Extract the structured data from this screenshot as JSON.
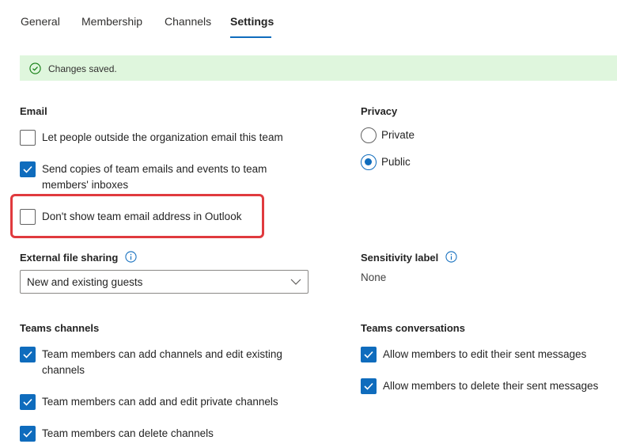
{
  "tabs": {
    "general": "General",
    "membership": "Membership",
    "channels": "Channels",
    "settings": "Settings"
  },
  "banner": {
    "message": "Changes saved."
  },
  "email": {
    "title": "Email",
    "outside_email": {
      "label": "Let people outside the organization email this team",
      "checked": false
    },
    "send_copies": {
      "label_line1": "Send copies of team emails and events to team",
      "label_line2": "members' inboxes",
      "checked": true
    },
    "hide_address": {
      "label": "Don't show team email address in Outlook",
      "checked": false
    }
  },
  "privacy": {
    "title": "Privacy",
    "options": [
      {
        "label": "Private",
        "selected": false
      },
      {
        "label": "Public",
        "selected": true
      }
    ]
  },
  "external_sharing": {
    "title": "External file sharing",
    "selected": "New and existing guests"
  },
  "sensitivity": {
    "title": "Sensitivity label",
    "value": "None"
  },
  "teams_channels": {
    "title": "Teams channels",
    "add_edit": {
      "label_line1": "Team members can add channels and edit existing",
      "label_line2": "channels",
      "checked": true
    },
    "private": {
      "label": "Team members can add and edit private channels",
      "checked": true
    },
    "delete": {
      "label": "Team members can delete channels",
      "checked": true
    }
  },
  "teams_conversations": {
    "title": "Teams conversations",
    "edit_sent": {
      "label": "Allow members to edit their sent messages",
      "checked": true
    },
    "delete_sent": {
      "label": "Allow members to delete their sent messages",
      "checked": true
    }
  },
  "colors": {
    "accent": "#0f6cbd",
    "success_bg": "#dff6dd",
    "success_icon": "#107c10",
    "highlight": "#e03a3e"
  }
}
